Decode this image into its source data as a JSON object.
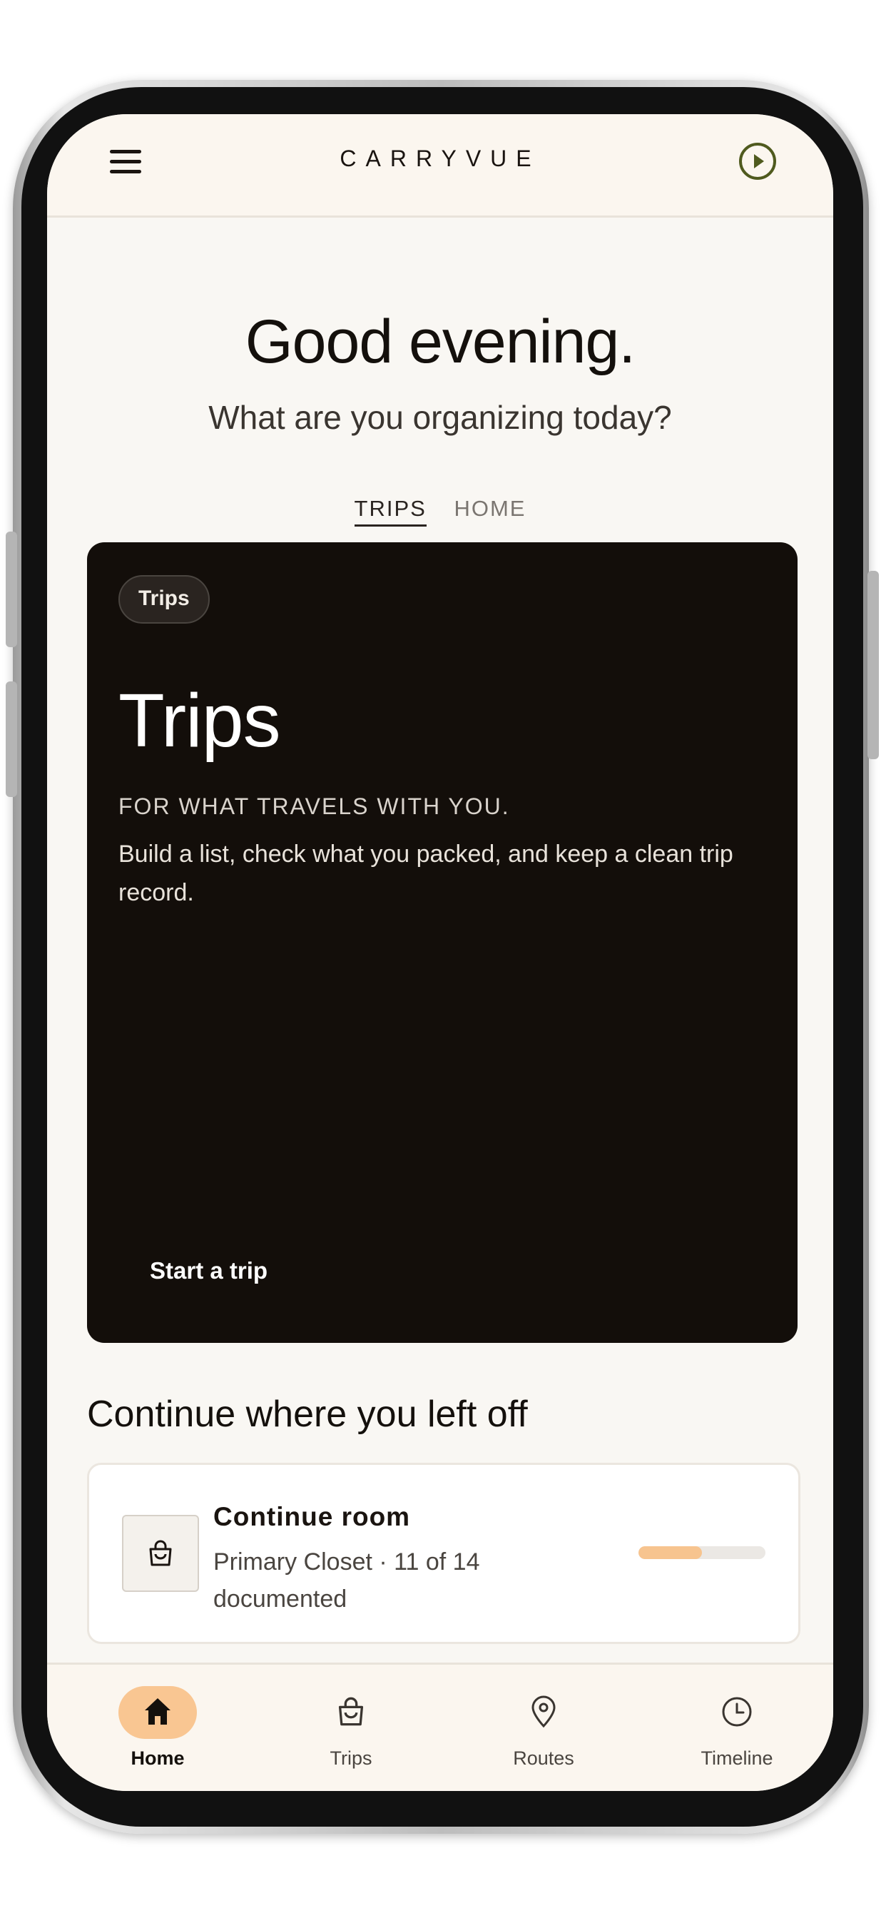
{
  "app": {
    "brand": "CARRYVUE"
  },
  "greeting": {
    "title": "Good evening.",
    "subtitle": "What are you organizing today?"
  },
  "tabs": [
    {
      "label": "TRIPS",
      "active": true
    },
    {
      "label": "HOME",
      "active": false
    }
  ],
  "hero": {
    "chip": "Trips",
    "title": "Trips",
    "tagline": "FOR WHAT TRAVELS WITH YOU.",
    "description": "Build a list, check what you packed, and keep a clean trip record.",
    "cta": "Start a trip"
  },
  "continue_section": {
    "title": "Continue where you left off",
    "card": {
      "title": "Continue room",
      "subtitle": "Primary Closet · 11 of 14 documented",
      "icon": "shopping-bag-icon",
      "progress": 0.5
    }
  },
  "bottom_nav": [
    {
      "label": "Home",
      "icon": "home-icon",
      "active": true
    },
    {
      "label": "Trips",
      "icon": "shopping-bag-icon",
      "active": false
    },
    {
      "label": "Routes",
      "icon": "map-pin-icon",
      "active": false
    },
    {
      "label": "Timeline",
      "icon": "clock-icon",
      "active": false
    }
  ],
  "colors": {
    "accent": "#f9c692",
    "hero_bg": "#130e0a",
    "screen_bg": "#f9f7f3"
  }
}
